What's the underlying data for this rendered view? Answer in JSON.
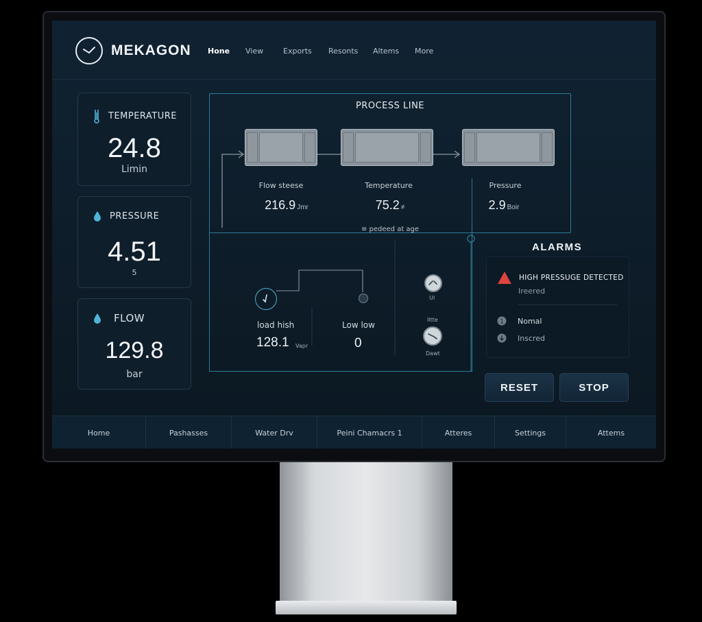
{
  "app": {
    "brand": "MEKAGON"
  },
  "nav": [
    "Hone",
    "View",
    "Exports",
    "Resonts",
    "Altems",
    "More"
  ],
  "stats": [
    {
      "label": "TEMPERATURE",
      "value": "24.8",
      "unit": "Limin",
      "icon": "thermometer-icon"
    },
    {
      "label": "PRESSURE",
      "value": "4.51",
      "unit": "5",
      "icon": "droplet-icon"
    },
    {
      "label": "FLOW",
      "value": "129.8",
      "unit": "bar",
      "icon": "droplet-icon"
    }
  ],
  "process": {
    "title": "PROCESS LINE",
    "units": [
      {
        "label": "Flow steese",
        "value": "216.9",
        "unit": "Jmr"
      },
      {
        "label": "Temperature",
        "value": "75.2",
        "unit": "≠"
      },
      {
        "label": "Pressure",
        "value": "2.9",
        "unit": "Boir"
      }
    ],
    "note": "≡ pedeed at age"
  },
  "lower": {
    "left_label": "load hish",
    "left_value": "128.1",
    "left_unit": "Vapr",
    "right_label": "Low low",
    "right_value": "0",
    "gauge1_label": "UI",
    "gauge2_top": "Iltte",
    "gauge2_label": "Dawt"
  },
  "alarms": {
    "title": "ALARMS",
    "items": [
      {
        "text": "HIGH PRESSUGE DETECTED",
        "sub": "Ireered",
        "icon": "warning-icon"
      },
      {
        "text": "Nomal",
        "icon": "info-circle-icon"
      },
      {
        "text": "Inscred",
        "icon": "down-circle-icon"
      }
    ]
  },
  "buttons": {
    "reset": "RESET",
    "stop": "STOP"
  },
  "bottom_nav": [
    "Home",
    "Pashasses",
    "Water Drv",
    "Peini Chamacrs 1",
    "Atteres",
    "Settings",
    "Attems"
  ],
  "colors": {
    "accent": "#2c7c96",
    "alarm_red": "#e0443e",
    "screen_bg": "#0e1d2a"
  }
}
